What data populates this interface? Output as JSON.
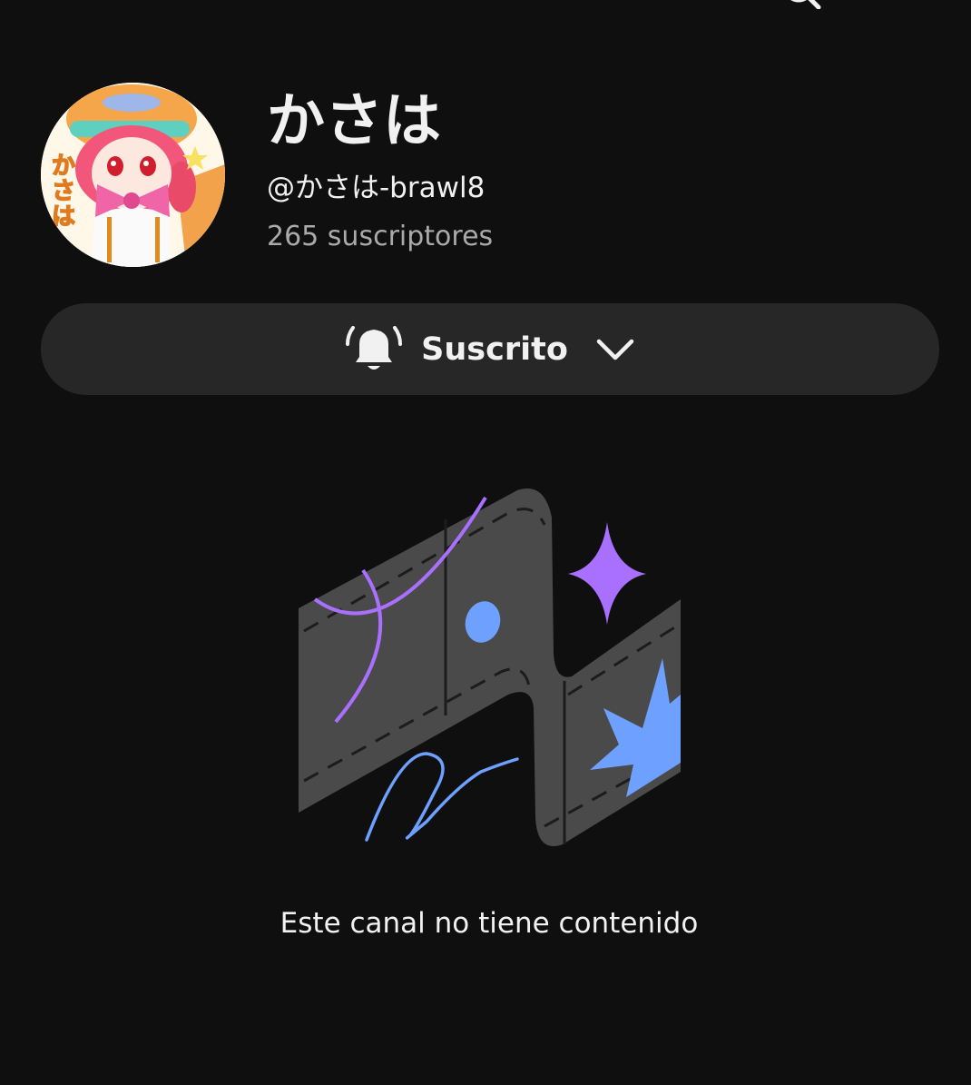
{
  "app_bar": {
    "back_icon": "arrow-back-icon",
    "search_icon": "search-icon",
    "more_icon": "more-vert-icon"
  },
  "channel": {
    "name": "かさは",
    "handle": "@かさは-brawl8",
    "subscribers": "265 suscriptores",
    "avatar_text": "かさは"
  },
  "subscribe_button": {
    "label": "Suscrito",
    "icon": "bell-icon",
    "dropdown_icon": "chevron-down-icon"
  },
  "empty_state": {
    "message": "Este canal no tiene contenido",
    "illustration": "empty-channel-illustration"
  },
  "colors": {
    "background": "#0f0f0f",
    "button_bg": "#272727",
    "secondary_text": "#aaaaaa",
    "accent_purple": "#a970ff",
    "accent_blue": "#6ea1ff",
    "illustration_gray": "#4a4a4a"
  }
}
